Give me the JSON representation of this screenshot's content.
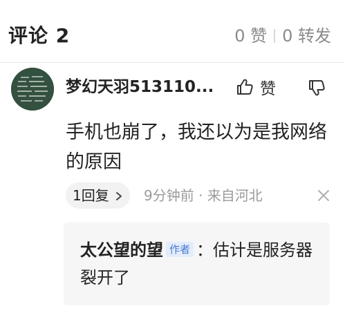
{
  "header": {
    "title": "评论 2",
    "likes": "0 赞",
    "reposts": "0 转发"
  },
  "comment": {
    "username": "梦幻天羽513110...",
    "like_label": "赞",
    "text": "手机也崩了，我还以为是我网络的原因",
    "reply_count_label": "1回复",
    "time_location": "9分钟前 · 来自河北"
  },
  "reply": {
    "author": "太公望的望",
    "author_tag": "作者",
    "separator": "：",
    "text": "估计是服务器裂开了"
  },
  "icons": {
    "like": "thumbs-up-icon",
    "dislike": "thumbs-down-icon",
    "chevron": "chevron-right-icon",
    "close": "close-icon"
  },
  "colors": {
    "text_primary": "#222222",
    "text_secondary": "#9b9b9b",
    "author_tag_text": "#4a7bd0",
    "author_tag_bg": "#e4ecfb",
    "reply_bg": "#f6f6f6"
  }
}
